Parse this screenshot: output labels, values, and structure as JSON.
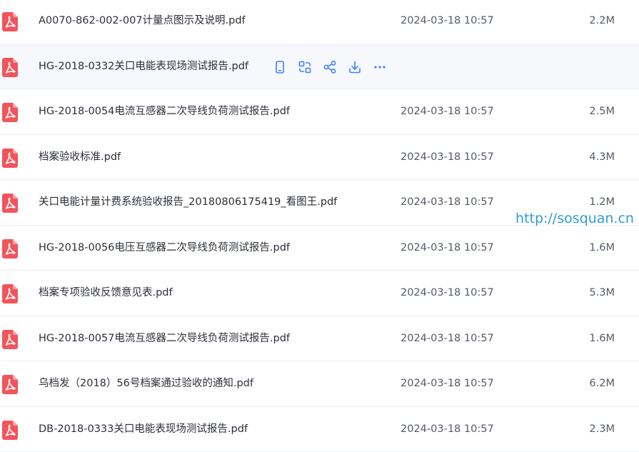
{
  "files": [
    {
      "name": "A0070-862-002-007计量点图示及说明.pdf",
      "date": "2024-03-18 10:57",
      "size": "2.2M"
    },
    {
      "name": "HG-2018-0332关口电能表现场测试报告.pdf",
      "date": "",
      "size": ""
    },
    {
      "name": "HG-2018-0054电流互感器二次导线负荷测试报告.pdf",
      "date": "2024-03-18 10:57",
      "size": "2.5M"
    },
    {
      "name": "档案验收标准.pdf",
      "date": "2024-03-18 10:57",
      "size": "4.3M"
    },
    {
      "name": "关口电能计量计费系统验收报告_20180806175419_看图王.pdf",
      "date": "2024-03-18 10:57",
      "size": "1.2M"
    },
    {
      "name": "HG-2018-0056电压互感器二次导线负荷测试报告.pdf",
      "date": "2024-03-18 10:57",
      "size": "1.6M"
    },
    {
      "name": "档案专项验收反馈意见表.pdf",
      "date": "2024-03-18 10:57",
      "size": "5.3M"
    },
    {
      "name": "HG-2018-0057电流互感器二次导线负荷测试报告.pdf",
      "date": "2024-03-18 10:57",
      "size": "1.6M"
    },
    {
      "name": "乌档发（2018）56号档案通过验收的通知.pdf",
      "date": "2024-03-18 10:57",
      "size": "6.2M"
    },
    {
      "name": "DB-2018-0333关口电能表现场测试报告.pdf",
      "date": "2024-03-18 10:57",
      "size": "2.3M"
    }
  ],
  "hover_actions": [
    "phone-icon",
    "convert-icon",
    "share-icon",
    "download-icon",
    "more-icon"
  ],
  "watermark": "http://sosquan.cn",
  "colors": {
    "pdf_icon": "#f2545b",
    "action_icon": "#3b82f6",
    "hover_row_bg": "#f6f8fc",
    "watermark": "#2f9bd8"
  }
}
